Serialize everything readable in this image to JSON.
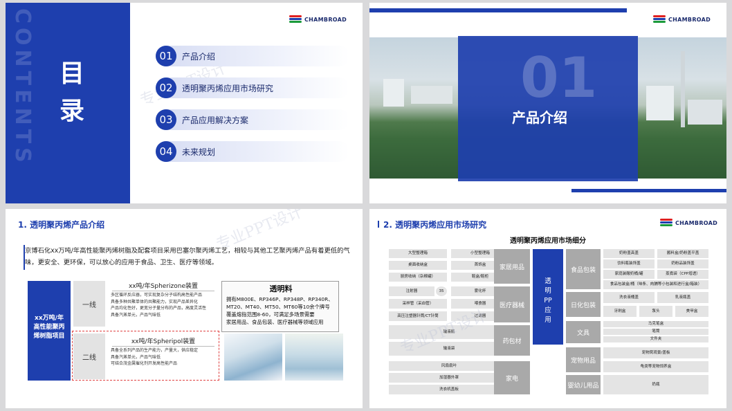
{
  "brand": {
    "logo_text": "CHAMBROAD"
  },
  "watermark": "专业PPT设计",
  "slide1": {
    "vertical_text": "CONTENTS",
    "title_chars": [
      "目",
      "录"
    ],
    "menu": [
      {
        "num": "01",
        "label": "产品介绍"
      },
      {
        "num": "02",
        "label": "透明聚丙烯应用市场研究"
      },
      {
        "num": "03",
        "label": "产品应用解决方案"
      },
      {
        "num": "04",
        "label": "未来规划"
      }
    ]
  },
  "slide2": {
    "big_number": "01",
    "title": "产品介绍"
  },
  "slide3": {
    "title": "1. 透明聚丙烯产品介绍",
    "paragraph": "京博石化xx万吨/年高性能聚丙烯树脂及配套项目采用巴塞尔聚丙烯工艺，相较与其他工艺聚丙烯产品有着更低的气味，更安全、更环保，可以放心的应用于食品、卫生、医疗等领域。",
    "navy_box": [
      "xx万吨/年",
      "高性能聚丙",
      "烯树脂项目"
    ],
    "lines": [
      {
        "label": "一线",
        "plant": "xx吨/年Spherizone装置",
        "points": [
          "多区循环反应器，可实现复杂分子结构高性能产品",
          "具备多种共聚单体的共聚能力，实现产品差异化",
          "产品均化性好，更宽分子量分布的产品，高度灵活性",
          "具备汽蒸单元，产品气味低"
        ]
      },
      {
        "label": "二线",
        "plant": "xx吨/年Spheripol装置",
        "points": [
          "具备全系列产品的生产能力，产量大，供应稳定",
          "具备汽蒸单元，产品气味低",
          "可结合茂金属催化剂开发高性能产品"
        ]
      }
    ],
    "transparent_box": {
      "title": "透明料",
      "lines": [
        "拥有M800E、RP346P、RP348P、RP340R、",
        "MT20、MT40、MT50、MT60等10余个牌号",
        "覆盖熔指范围8-60，可满足多场景需要",
        "家居用品、食品包装、医疗器械等领域应用"
      ]
    }
  },
  "slide4": {
    "title": "2. 透明聚丙烯应用市场研究",
    "table_title": "透明聚丙烯应用市场细分",
    "center_label": [
      "透",
      "明",
      "PP",
      "应",
      "用"
    ],
    "left_categories": [
      "家居用品",
      "医疗器械",
      "药包材",
      "家电"
    ],
    "right_categories": [
      "食品包装",
      "日化包装",
      "文具",
      "宠物用品",
      "婴幼儿用品"
    ],
    "left_cells": [
      "大型整理箱",
      "小型整理箱",
      "桌面收纳盒",
      "首饰盒",
      "厨房收纳（杂粮罐）",
      "鞋盒/鞋柜",
      "注射器",
      "35",
      "雾化杯",
      "采样管（采血管）",
      "喂食器",
      "高压注塑器针筒/CT针筒",
      "过滤器",
      "输液瓶",
      "输液袋",
      "风扇扇叶",
      "加湿器外罩",
      "洗衣机盖板"
    ],
    "right_cells": [
      "奶粉盖高盖",
      "酱料盒/奶粉盖平盖",
      "饮料瓶装饰盖",
      "奶粉品装饰盖",
      "家庭装酸奶桶/罐",
      "蒸煮袋（CPP增透）",
      "食品包装盒/桶（味条、肉脯等小包装和进行盒/箱装）",
      "洗衣液桶盖",
      "乳液瓶盖",
      "牙刷盒",
      "泵头",
      "美甲盒",
      "马克笔盒",
      "笔筒",
      "文件夹",
      "宠物窝观景/盖板",
      "龟类等宠物饲养盒",
      "奶瓶"
    ]
  }
}
